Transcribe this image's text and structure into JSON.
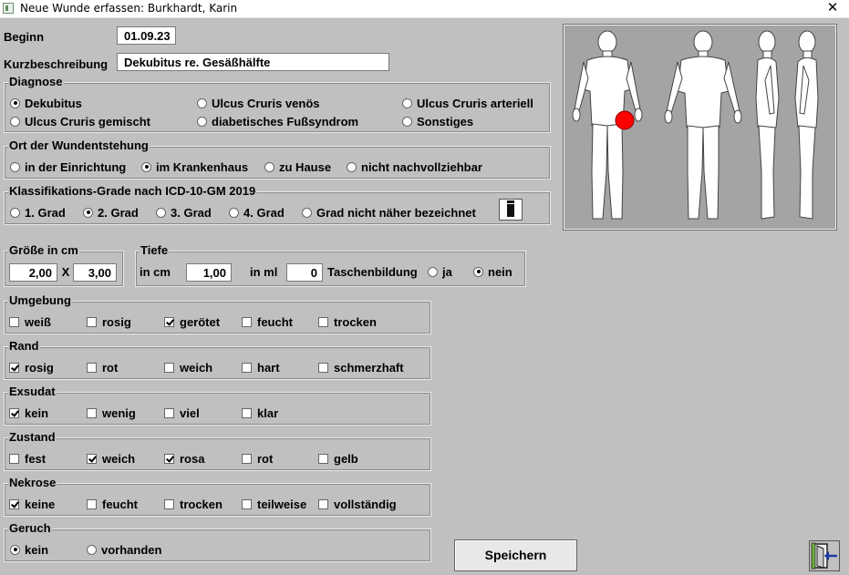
{
  "window": {
    "title": "Neue Wunde erfassen: Burkhardt, Karin",
    "close_glyph": "✕"
  },
  "beginn": {
    "label": "Beginn",
    "value": "01.09.23"
  },
  "kurzbeschreibung": {
    "label": "Kurzbeschreibung",
    "value": "Dekubitus re. Gesäßhälfte"
  },
  "diagnose": {
    "title": "Diagnose",
    "options": [
      {
        "label": "Dekubitus",
        "selected": true
      },
      {
        "label": "Ulcus Cruris venös",
        "selected": false
      },
      {
        "label": "Ulcus Cruris arteriell",
        "selected": false
      },
      {
        "label": "Ulcus Cruris gemischt",
        "selected": false
      },
      {
        "label": "diabetisches Fußsyndrom",
        "selected": false
      },
      {
        "label": "Sonstiges",
        "selected": false
      }
    ]
  },
  "ort": {
    "title": "Ort der Wundentstehung",
    "options": [
      {
        "label": "in der Einrichtung",
        "selected": false
      },
      {
        "label": "im Krankenhaus",
        "selected": true
      },
      {
        "label": "zu Hause",
        "selected": false
      },
      {
        "label": "nicht nachvollziehbar",
        "selected": false
      }
    ]
  },
  "klassifikation": {
    "title": "Klassifikations-Grade nach ICD-10-GM 2019",
    "info_icon": "info-icon",
    "options": [
      {
        "label": "1. Grad",
        "selected": false
      },
      {
        "label": "2. Grad",
        "selected": true
      },
      {
        "label": "3. Grad",
        "selected": false
      },
      {
        "label": "4. Grad",
        "selected": false
      },
      {
        "label": "Grad nicht näher bezeichnet",
        "selected": false
      }
    ]
  },
  "groesse": {
    "title": "Größe in cm",
    "width": "2,00",
    "times": "X",
    "height": "3,00"
  },
  "tiefe": {
    "title": "Tiefe",
    "cm_label": "in cm",
    "cm_value": "1,00",
    "ml_label": "in ml",
    "ml_value": "0",
    "tasche_label": "Taschenbildung",
    "options": [
      {
        "label": "ja",
        "selected": false
      },
      {
        "label": "nein",
        "selected": true
      }
    ]
  },
  "umgebung": {
    "title": "Umgebung",
    "items": [
      {
        "label": "weiß",
        "checked": false
      },
      {
        "label": "rosig",
        "checked": false
      },
      {
        "label": "gerötet",
        "checked": true
      },
      {
        "label": "feucht",
        "checked": false
      },
      {
        "label": "trocken",
        "checked": false
      }
    ]
  },
  "rand": {
    "title": "Rand",
    "items": [
      {
        "label": "rosig",
        "checked": true
      },
      {
        "label": "rot",
        "checked": false
      },
      {
        "label": "weich",
        "checked": false
      },
      {
        "label": "hart",
        "checked": false
      },
      {
        "label": "schmerzhaft",
        "checked": false
      }
    ]
  },
  "exsudat": {
    "title": "Exsudat",
    "items": [
      {
        "label": "kein",
        "checked": true
      },
      {
        "label": "wenig",
        "checked": false
      },
      {
        "label": "viel",
        "checked": false
      },
      {
        "label": "klar",
        "checked": false
      }
    ]
  },
  "zustand": {
    "title": "Zustand",
    "items": [
      {
        "label": "fest",
        "checked": false
      },
      {
        "label": "weich",
        "checked": true
      },
      {
        "label": "rosa",
        "checked": true
      },
      {
        "label": "rot",
        "checked": false
      },
      {
        "label": "gelb",
        "checked": false
      }
    ]
  },
  "nekrose": {
    "title": "Nekrose",
    "items": [
      {
        "label": "keine",
        "checked": true
      },
      {
        "label": "feucht",
        "checked": false
      },
      {
        "label": "trocken",
        "checked": false
      },
      {
        "label": "teilweise",
        "checked": false
      },
      {
        "label": "vollständig",
        "checked": false
      }
    ]
  },
  "geruch": {
    "title": "Geruch",
    "options": [
      {
        "label": "kein",
        "selected": true
      },
      {
        "label": "vorhanden",
        "selected": false
      }
    ]
  },
  "body_map": {
    "marker_color": "#ff0000",
    "marker_site": "right buttock"
  },
  "buttons": {
    "save_label": "Speichern",
    "exit_icon": "exit-door-icon"
  }
}
